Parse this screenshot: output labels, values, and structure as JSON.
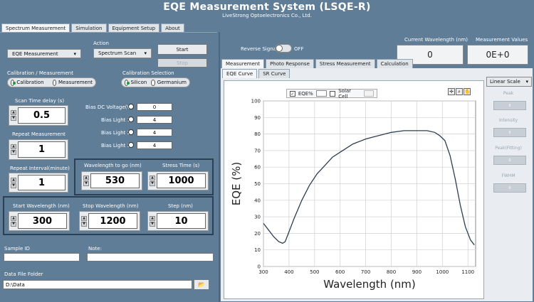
{
  "app": {
    "title": "EQE Measurement System  (LSQE-R)",
    "subtitle": "LiveStrong Optoelectronics Co., Ltd."
  },
  "main_tabs": [
    "Spectrum Measurement",
    "Simulation",
    "Equipment Setup",
    "About"
  ],
  "action": {
    "label": "Action",
    "measure_select": "EQE Measurement",
    "scan_select": "Spectrum Scan",
    "start": "Start",
    "stop": "Stop"
  },
  "calibration_measurement": {
    "label": "Calibration / Measurement",
    "option1": "Calibration",
    "option2": "Measurement",
    "selected": "Calibration"
  },
  "calibration_selection": {
    "label": "Calibration Selection",
    "option1": "Silicon",
    "option2": "Germanium",
    "selected": "Silicon"
  },
  "scan_time_delay": {
    "label": "Scan Time delay (s)",
    "value": "0.5"
  },
  "repeat_measurement": {
    "label": "Repeat Measurement",
    "value": "1"
  },
  "repeat_interval": {
    "label": "Repeat Interval(minute)",
    "value": "1"
  },
  "bias": {
    "dc_label": "Bias DC Voltage(V)",
    "dc_value": "0",
    "light1_label": "Bias Light 1",
    "light1_value": "4",
    "light2_label": "Bias Light 2",
    "light2_value": "4",
    "light3_label": "Bias Light 3",
    "light3_value": "4"
  },
  "wavelength_to_go": {
    "label": "Wavelength to go (nm)",
    "value": "530"
  },
  "stress_time": {
    "label": "Stress Time (s)",
    "value": "1000"
  },
  "start_wavelength": {
    "label": "Start Wavelength (nm)",
    "value": "300"
  },
  "stop_wavelength": {
    "label": "Stop Wavelength (nm)",
    "value": "1200"
  },
  "step": {
    "label": "Step (nm)",
    "value": "10"
  },
  "sample_id": {
    "label": "Sample ID",
    "value": ""
  },
  "note": {
    "label": "Note:",
    "value": ""
  },
  "data_folder": {
    "label": "Data File Folder",
    "value": "D:\\Data"
  },
  "reverse_signal": {
    "label": "Reverse Signal",
    "state": "OFF"
  },
  "current_wavelength": {
    "label": "Current Wavelength (nm)",
    "value": "0"
  },
  "measurement_values": {
    "label": "Measurement Values",
    "value": "0E+0"
  },
  "sub_tabs": [
    "Measurement",
    "Photo Response",
    "Stress Measurement",
    "Calculation"
  ],
  "graph_tabs": [
    "EQE Curve",
    "SR Curve"
  ],
  "scale_select": "Linear Scale",
  "side_buttons": {
    "peak": "Peak",
    "intensity": "Intensity",
    "peak_fitting": "Peak(Fitting)",
    "fwhm": "FWHM",
    "zero": "0"
  },
  "legend": {
    "eqe": "EQE%",
    "solar": "Solar Cell"
  },
  "colors": {
    "background": "#5f7d97",
    "curve": "#2d3e50",
    "radio_on": "#1c9a3b"
  },
  "chart_data": {
    "type": "line",
    "xlabel": "Wavelength (nm)",
    "ylabel": "EQE (%)",
    "xlim": [
      300,
      1130
    ],
    "ylim": [
      0,
      100
    ],
    "xticks": [
      300,
      400,
      500,
      600,
      700,
      800,
      900,
      1000,
      1100
    ],
    "yticks": [
      0,
      10,
      20,
      30,
      40,
      50,
      60,
      70,
      80,
      90,
      100
    ],
    "grid": true,
    "series": [
      {
        "name": "EQE%",
        "x": [
          300,
          320,
          340,
          360,
          375,
          385,
          400,
          420,
          450,
          480,
          510,
          540,
          570,
          600,
          650,
          700,
          750,
          800,
          850,
          900,
          940,
          970,
          990,
          1010,
          1030,
          1050,
          1070,
          1090,
          1110,
          1125
        ],
        "y": [
          26,
          22,
          18,
          15,
          14,
          15,
          21,
          29,
          40,
          49,
          56,
          61,
          66,
          69,
          74,
          77,
          79,
          81,
          82,
          82,
          82,
          81,
          79,
          76,
          67,
          53,
          37,
          24,
          16,
          13
        ]
      }
    ]
  }
}
